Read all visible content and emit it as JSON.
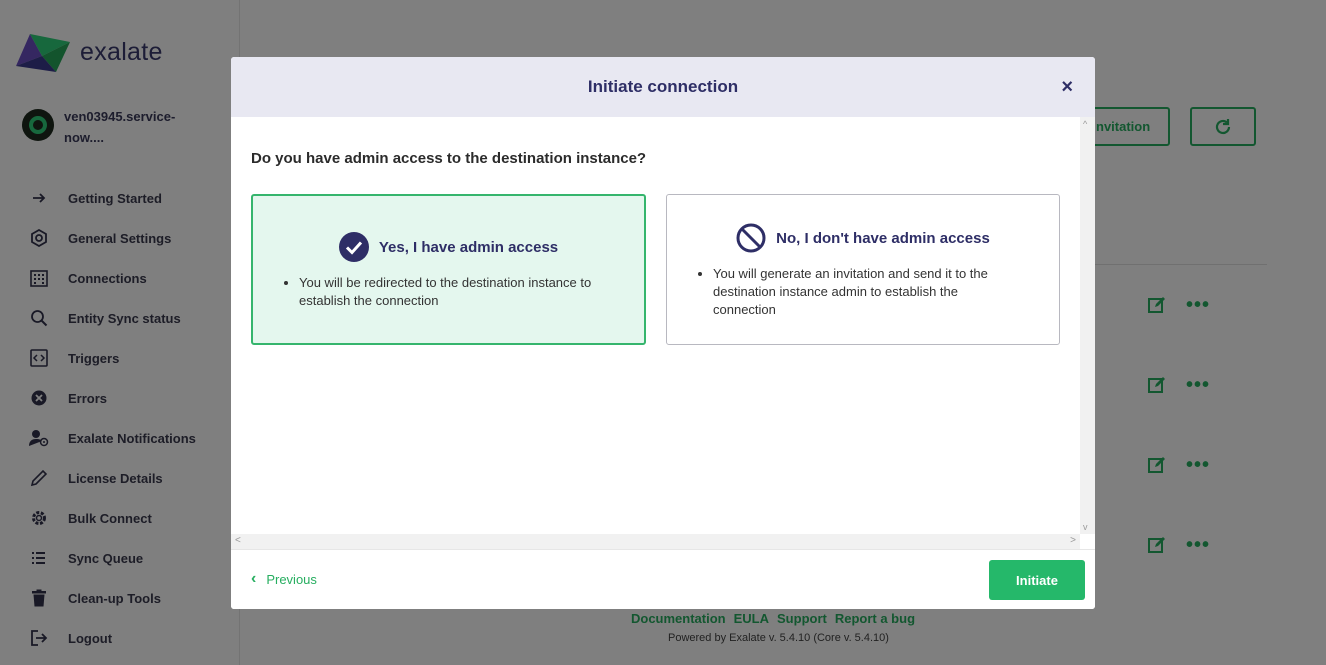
{
  "app": {
    "logo_text": "exalate"
  },
  "user": {
    "name": "ven03945.service-now...."
  },
  "sidebar": {
    "items": [
      {
        "label": "Getting Started",
        "icon": "arrow-right-icon"
      },
      {
        "label": "General Settings",
        "icon": "hexagon-gear-icon"
      },
      {
        "label": "Connections",
        "icon": "building-icon"
      },
      {
        "label": "Entity Sync status",
        "icon": "search-icon"
      },
      {
        "label": "Triggers",
        "icon": "code-icon"
      },
      {
        "label": "Errors",
        "icon": "error-icon"
      },
      {
        "label": "Exalate Notifications",
        "icon": "user-notification-icon"
      },
      {
        "label": "License Details",
        "icon": "pencil-icon"
      },
      {
        "label": "Bulk Connect",
        "icon": "gear-icon"
      },
      {
        "label": "Sync Queue",
        "icon": "list-icon"
      },
      {
        "label": "Clean-up Tools",
        "icon": "trash-icon"
      },
      {
        "label": "Logout",
        "icon": "logout-icon"
      }
    ]
  },
  "background": {
    "invite_button_partial": "nvitation"
  },
  "footer": {
    "links": [
      "Documentation",
      "EULA",
      "Support",
      "Report a bug"
    ],
    "powered": "Powered by Exalate v. 5.4.10 (Core v. 5.4.10)"
  },
  "modal": {
    "title": "Initiate connection",
    "close": "×",
    "question": "Do you have admin access to the destination instance?",
    "option_yes": {
      "title": "Yes, I have admin access",
      "bullet": "You will be redirected to the destination instance to establish the connection",
      "selected": true
    },
    "option_no": {
      "title": "No, I don't have admin access",
      "bullet": "You will generate an invitation and send it to the destination instance admin to establish the connection",
      "selected": false
    },
    "previous": "Previous",
    "initiate": "Initiate"
  },
  "colors": {
    "accent": "#25b86a",
    "brand_dark": "#2e2e66",
    "selected_bg": "#e4f7ee"
  }
}
